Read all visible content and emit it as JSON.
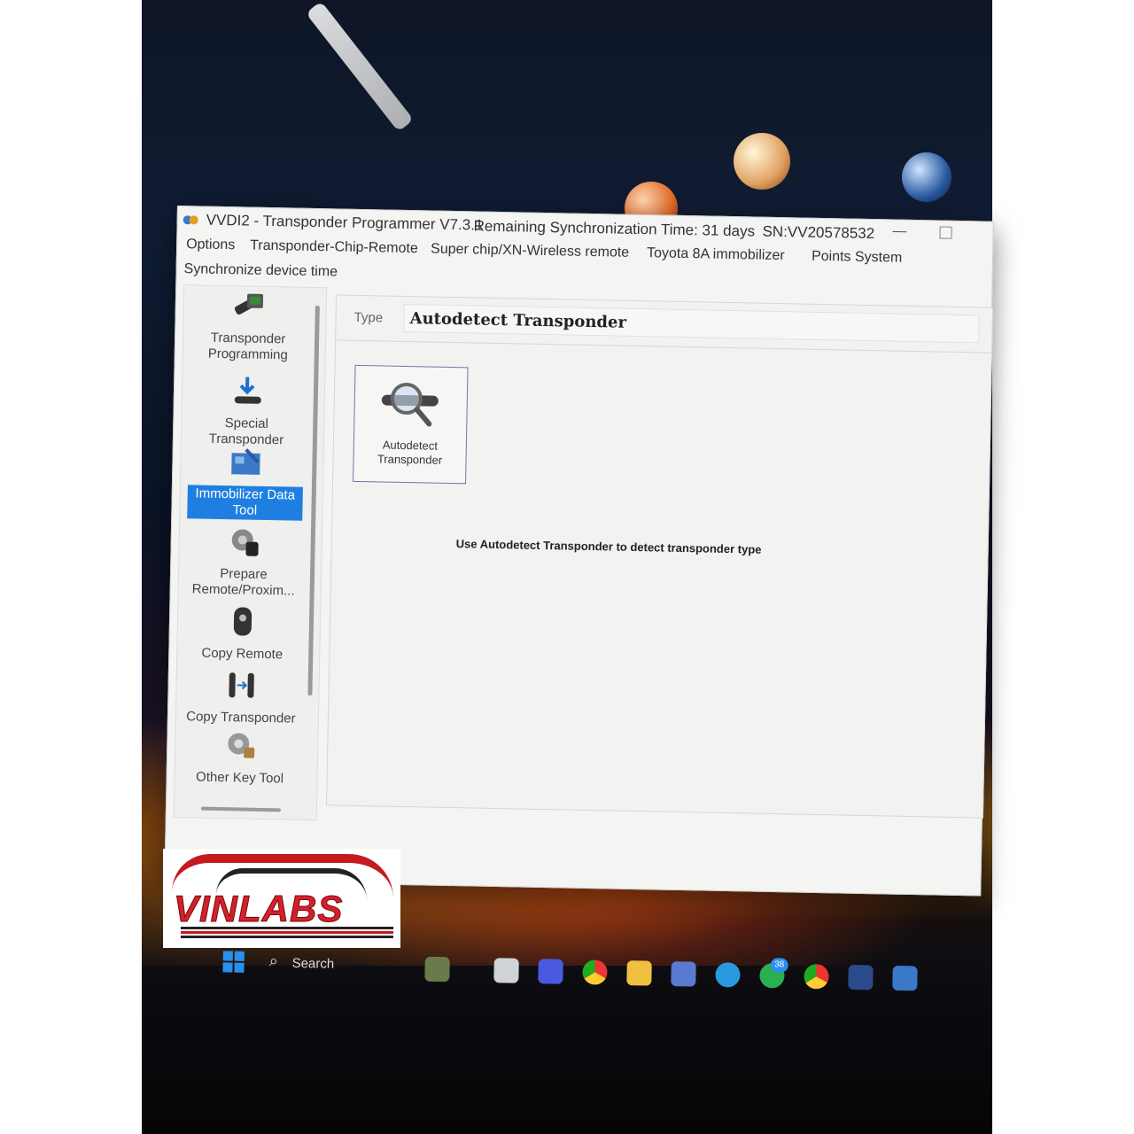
{
  "window": {
    "title": "VVDI2 - Transponder Programmer V7.3.1",
    "sync_status": "Remaining Synchronization Time: 31 days",
    "serial": "SN:VV20578532"
  },
  "menu": {
    "items": [
      "Options",
      "Transponder-Chip-Remote",
      "Super chip/XN-Wireless remote",
      "Toyota 8A immobilizer",
      "Points System"
    ],
    "second_row": "Synchronize device time"
  },
  "sidebar": {
    "items": [
      {
        "label": "Transponder Programming",
        "icon": "transponder-programming-icon",
        "active": false
      },
      {
        "label": "Special Transponder",
        "icon": "special-transponder-icon",
        "active": false
      },
      {
        "label": "Immobilizer Data Tool",
        "icon": "immobilizer-data-tool-icon",
        "active": true
      },
      {
        "label": "Prepare Remote/Proxim...",
        "icon": "prepare-remote-icon",
        "active": false
      },
      {
        "label": "Copy Remote",
        "icon": "copy-remote-icon",
        "active": false
      },
      {
        "label": "Copy Transponder",
        "icon": "copy-transponder-icon",
        "active": false
      },
      {
        "label": "Other Key Tool",
        "icon": "other-key-tool-icon",
        "active": false
      }
    ]
  },
  "main": {
    "type_label": "Type",
    "type_value": "Autodetect Transponder",
    "tile_label": "Autodetect Transponder",
    "hint": "Use Autodetect Transponder to detect transponder type"
  },
  "overlay": {
    "logo_text": "VINLABS"
  },
  "taskbar": {
    "search_label": "Search",
    "whatsapp_badge": "38"
  },
  "colors": {
    "selection": "#1f7fe0",
    "logo_red": "#d4202a"
  }
}
